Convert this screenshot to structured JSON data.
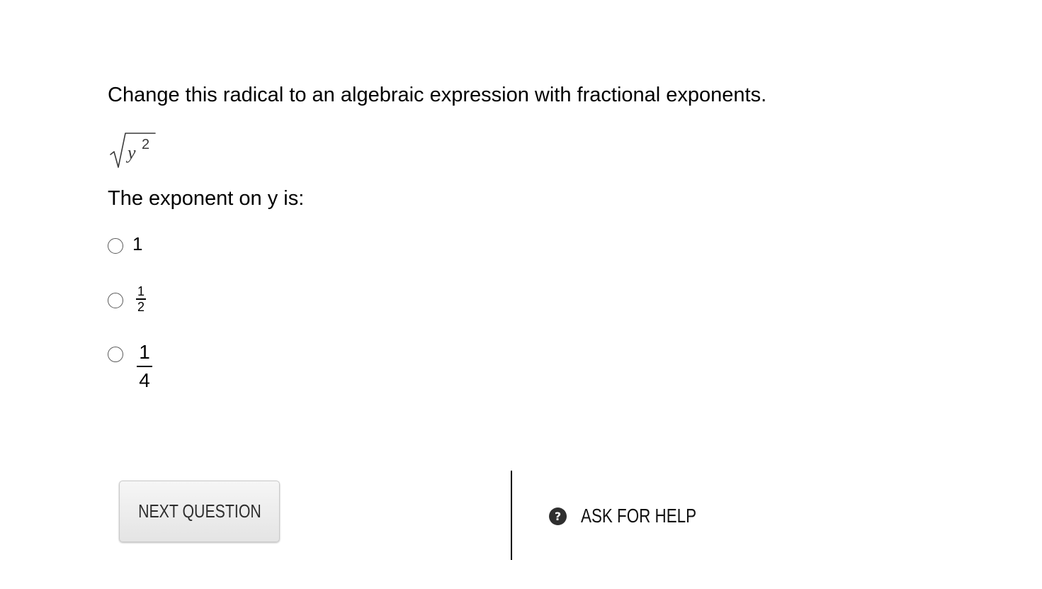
{
  "question": {
    "prompt": "Change this radical to an algebraic expression with fractional exponents.",
    "expression": {
      "base": "y",
      "power": "2"
    },
    "sub_prompt": "The exponent on y is:"
  },
  "options": [
    {
      "label": "1"
    },
    {
      "numerator": "1",
      "denominator": "2"
    },
    {
      "numerator": "1",
      "denominator": "4"
    }
  ],
  "footer": {
    "next_label": "NEXT QUESTION",
    "help_icon": "question-circle-icon",
    "help_icon_glyph": "?",
    "help_label": "ASK FOR HELP"
  }
}
